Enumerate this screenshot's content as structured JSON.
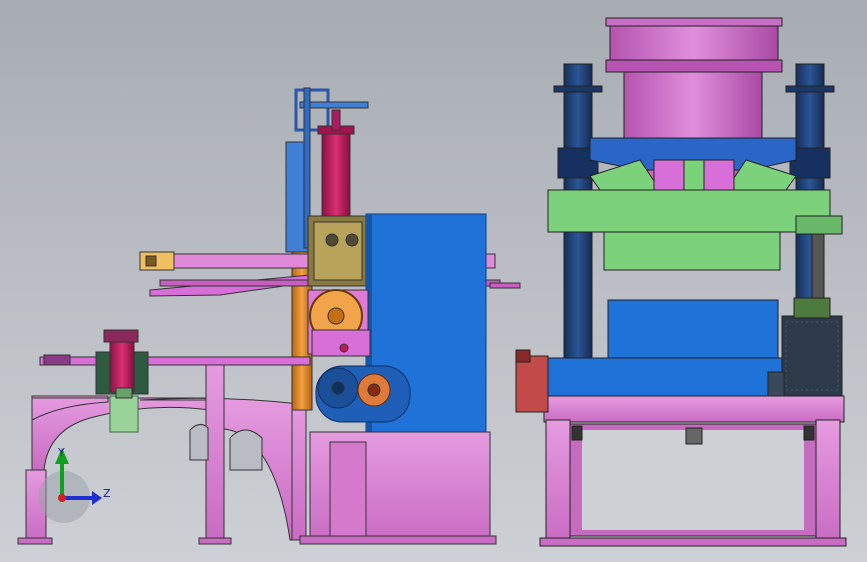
{
  "viewport": {
    "background_top": "#a7acb3",
    "background_bottom": "#cdd0d4"
  },
  "colors": {
    "frame_pink": "#d77fd0",
    "frame_pink_dark": "#8a3a86",
    "column_blue": "#1f3f73",
    "panel_blue": "#1f72d8",
    "press_green": "#7cd27b",
    "cylinder_magenta": "#d86ed8",
    "rod_crimson": "#c2185b",
    "gear_orange": "#f2a44a",
    "motor_dark": "#2d3a4a",
    "column_orange": "#e08a2a"
  },
  "triad": {
    "icon": "xyz-coordinate-triad-icon",
    "y_label": "Y",
    "z_label": "Z",
    "y_color": "#10a020",
    "z_color": "#2030d0",
    "x_color": "#d02020"
  }
}
